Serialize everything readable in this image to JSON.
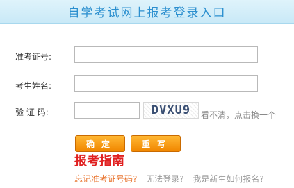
{
  "header": {
    "title": "自学考试网上报考登录入口"
  },
  "form": {
    "admission_label": "准考证号:",
    "admission_value": "",
    "name_label": "考生姓名:",
    "name_value": "",
    "captcha_label": "验 证 码:",
    "captcha_value": "",
    "captcha_text": "DVXU9",
    "refresh_tip": "看不清，点击换一个"
  },
  "buttons": {
    "confirm": "确定",
    "reset": "重写"
  },
  "guide": {
    "title": "报考指南",
    "links": [
      {
        "label": "忘记准考证号码?"
      },
      {
        "label": "无法登录?"
      },
      {
        "label": "我是新生如何报名?"
      }
    ]
  },
  "colors": {
    "header_text": "#2b8fcf",
    "button_orange": "#f18700",
    "guide_red": "#e02020",
    "link_orange": "#e8732c",
    "link_gray": "#9a9a9a"
  }
}
